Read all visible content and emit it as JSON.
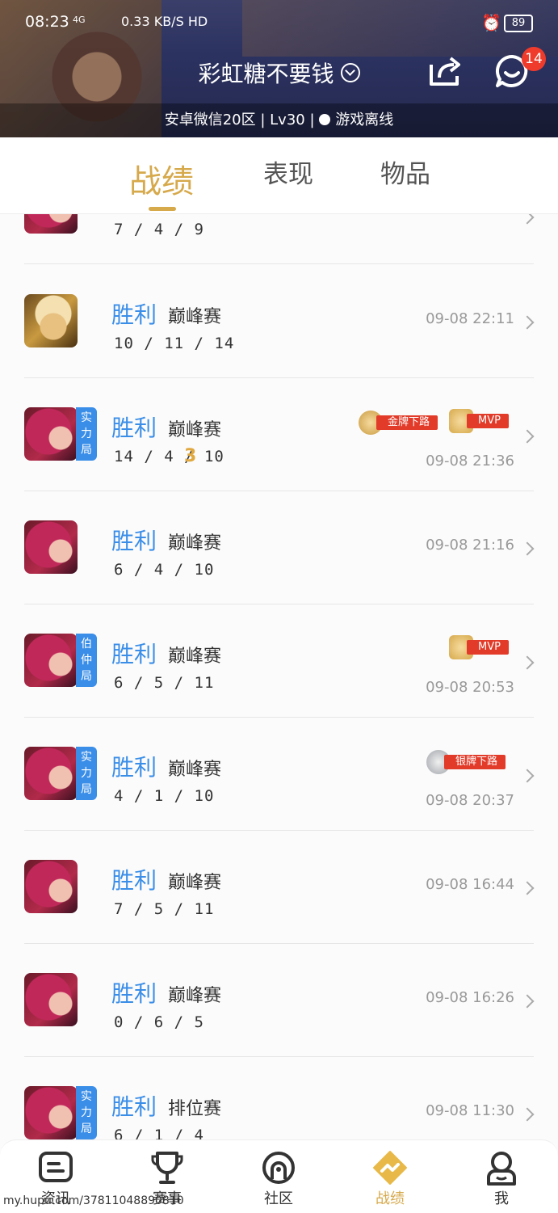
{
  "status_bar": {
    "time": "08:23",
    "signal": "4G",
    "net_speed": "0.33 KB/S HD",
    "battery": "89"
  },
  "header": {
    "title": "彩虹糖不要钱",
    "subinfo": "安卓微信20区 | Lv30 | ",
    "status": "游戏离线",
    "message_badge": "14"
  },
  "tabs": [
    {
      "label": "战绩",
      "active": true
    },
    {
      "label": "表现",
      "active": false
    },
    {
      "label": "物品",
      "active": false
    }
  ],
  "matches": [
    {
      "avatar": "red",
      "tag": "",
      "result": "",
      "mode": "",
      "kda": "7 / 4 / 9",
      "time": "",
      "partial": true
    },
    {
      "avatar": "gold",
      "tag": "",
      "result": "胜利",
      "mode": "巅峰赛",
      "kda": "10 / 11 / 14",
      "time": "09-08 22:11"
    },
    {
      "avatar": "red",
      "tag": "实力局",
      "result": "胜利",
      "mode": "巅峰赛",
      "kda": "14 / 4 / 10",
      "time": "09-08 21:36",
      "badges": [
        "金牌下路",
        "MVP"
      ],
      "extra": "3"
    },
    {
      "avatar": "red",
      "tag": "",
      "result": "胜利",
      "mode": "巅峰赛",
      "kda": "6 / 4 / 10",
      "time": "09-08 21:16"
    },
    {
      "avatar": "red",
      "tag": "伯仲局",
      "result": "胜利",
      "mode": "巅峰赛",
      "kda": "6 / 5 / 11",
      "time": "09-08 20:53",
      "badges": [
        "MVP"
      ]
    },
    {
      "avatar": "red",
      "tag": "实力局",
      "result": "胜利",
      "mode": "巅峰赛",
      "kda": "4 / 1 / 10",
      "time": "09-08 20:37",
      "badges": [
        "银牌下路"
      ]
    },
    {
      "avatar": "red",
      "tag": "",
      "result": "胜利",
      "mode": "巅峰赛",
      "kda": "7 / 5 / 11",
      "time": "09-08 16:44"
    },
    {
      "avatar": "red",
      "tag": "",
      "result": "胜利",
      "mode": "巅峰赛",
      "kda": "0 / 6 / 5",
      "time": "09-08 16:26"
    },
    {
      "avatar": "red",
      "tag": "实力局",
      "result": "胜利",
      "mode": "排位赛",
      "kda": "6 / 1 / 4",
      "time": "09-08 11:30"
    }
  ],
  "bottom_nav": [
    {
      "label": "资讯",
      "icon": "news-icon",
      "active": false
    },
    {
      "label": "赛事",
      "icon": "trophy-icon",
      "active": false
    },
    {
      "label": "社区",
      "icon": "community-icon",
      "active": false
    },
    {
      "label": "战绩",
      "icon": "record-icon",
      "active": true
    },
    {
      "label": "我",
      "icon": "profile-icon",
      "active": false
    }
  ],
  "watermark": "my.hupu.com/37811048890810",
  "colors": {
    "accent": "#d6a94b",
    "win": "#3a8ee8",
    "badge": "#ef3b2c"
  }
}
